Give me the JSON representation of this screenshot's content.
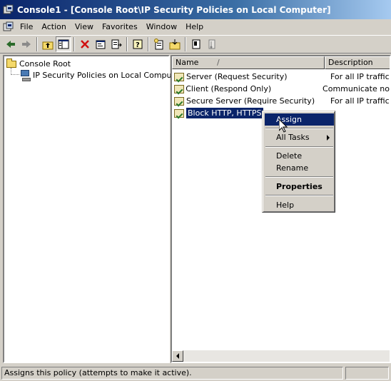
{
  "window": {
    "title": "Console1 - [Console Root\\IP Security Policies on Local Computer]"
  },
  "menu": [
    {
      "label": "File"
    },
    {
      "label": "Action"
    },
    {
      "label": "View"
    },
    {
      "label": "Favorites"
    },
    {
      "label": "Window"
    },
    {
      "label": "Help"
    }
  ],
  "toolbar": {
    "icons": [
      "back-icon",
      "forward-icon",
      "up-level-icon",
      "show-hide-tree-icon",
      "delete-icon",
      "properties-icon",
      "export-list-icon",
      "help-icon",
      "new-policy-icon",
      "import-icon",
      "manage-filters-icon",
      "wizard-icon"
    ]
  },
  "tree": {
    "root": "Console Root",
    "child": "IP Security Policies on Local Computer"
  },
  "list": {
    "columns": [
      "Name",
      "Description"
    ],
    "sort_indicator": "/",
    "rows": [
      {
        "name": "Server (Request Security)",
        "description": "For all IP traffic, a"
      },
      {
        "name": "Client (Respond Only)",
        "description": "Communicate norm"
      },
      {
        "name": "Secure Server (Require Security)",
        "description": "For all IP traffic, a"
      },
      {
        "name": "Block HTTP, HTTPS",
        "description": ""
      }
    ]
  },
  "context_menu": {
    "items": [
      {
        "label": "Assign"
      },
      {
        "label": "All Tasks"
      },
      {
        "label": "Delete"
      },
      {
        "label": "Rename"
      },
      {
        "label": "Properties"
      },
      {
        "label": "Help"
      }
    ]
  },
  "status": {
    "text": "Assigns this policy (attempts to make it active)."
  },
  "colors": {
    "title_start": "#0a246a",
    "selection": "#0a246a",
    "chrome": "#d4d0c8"
  }
}
